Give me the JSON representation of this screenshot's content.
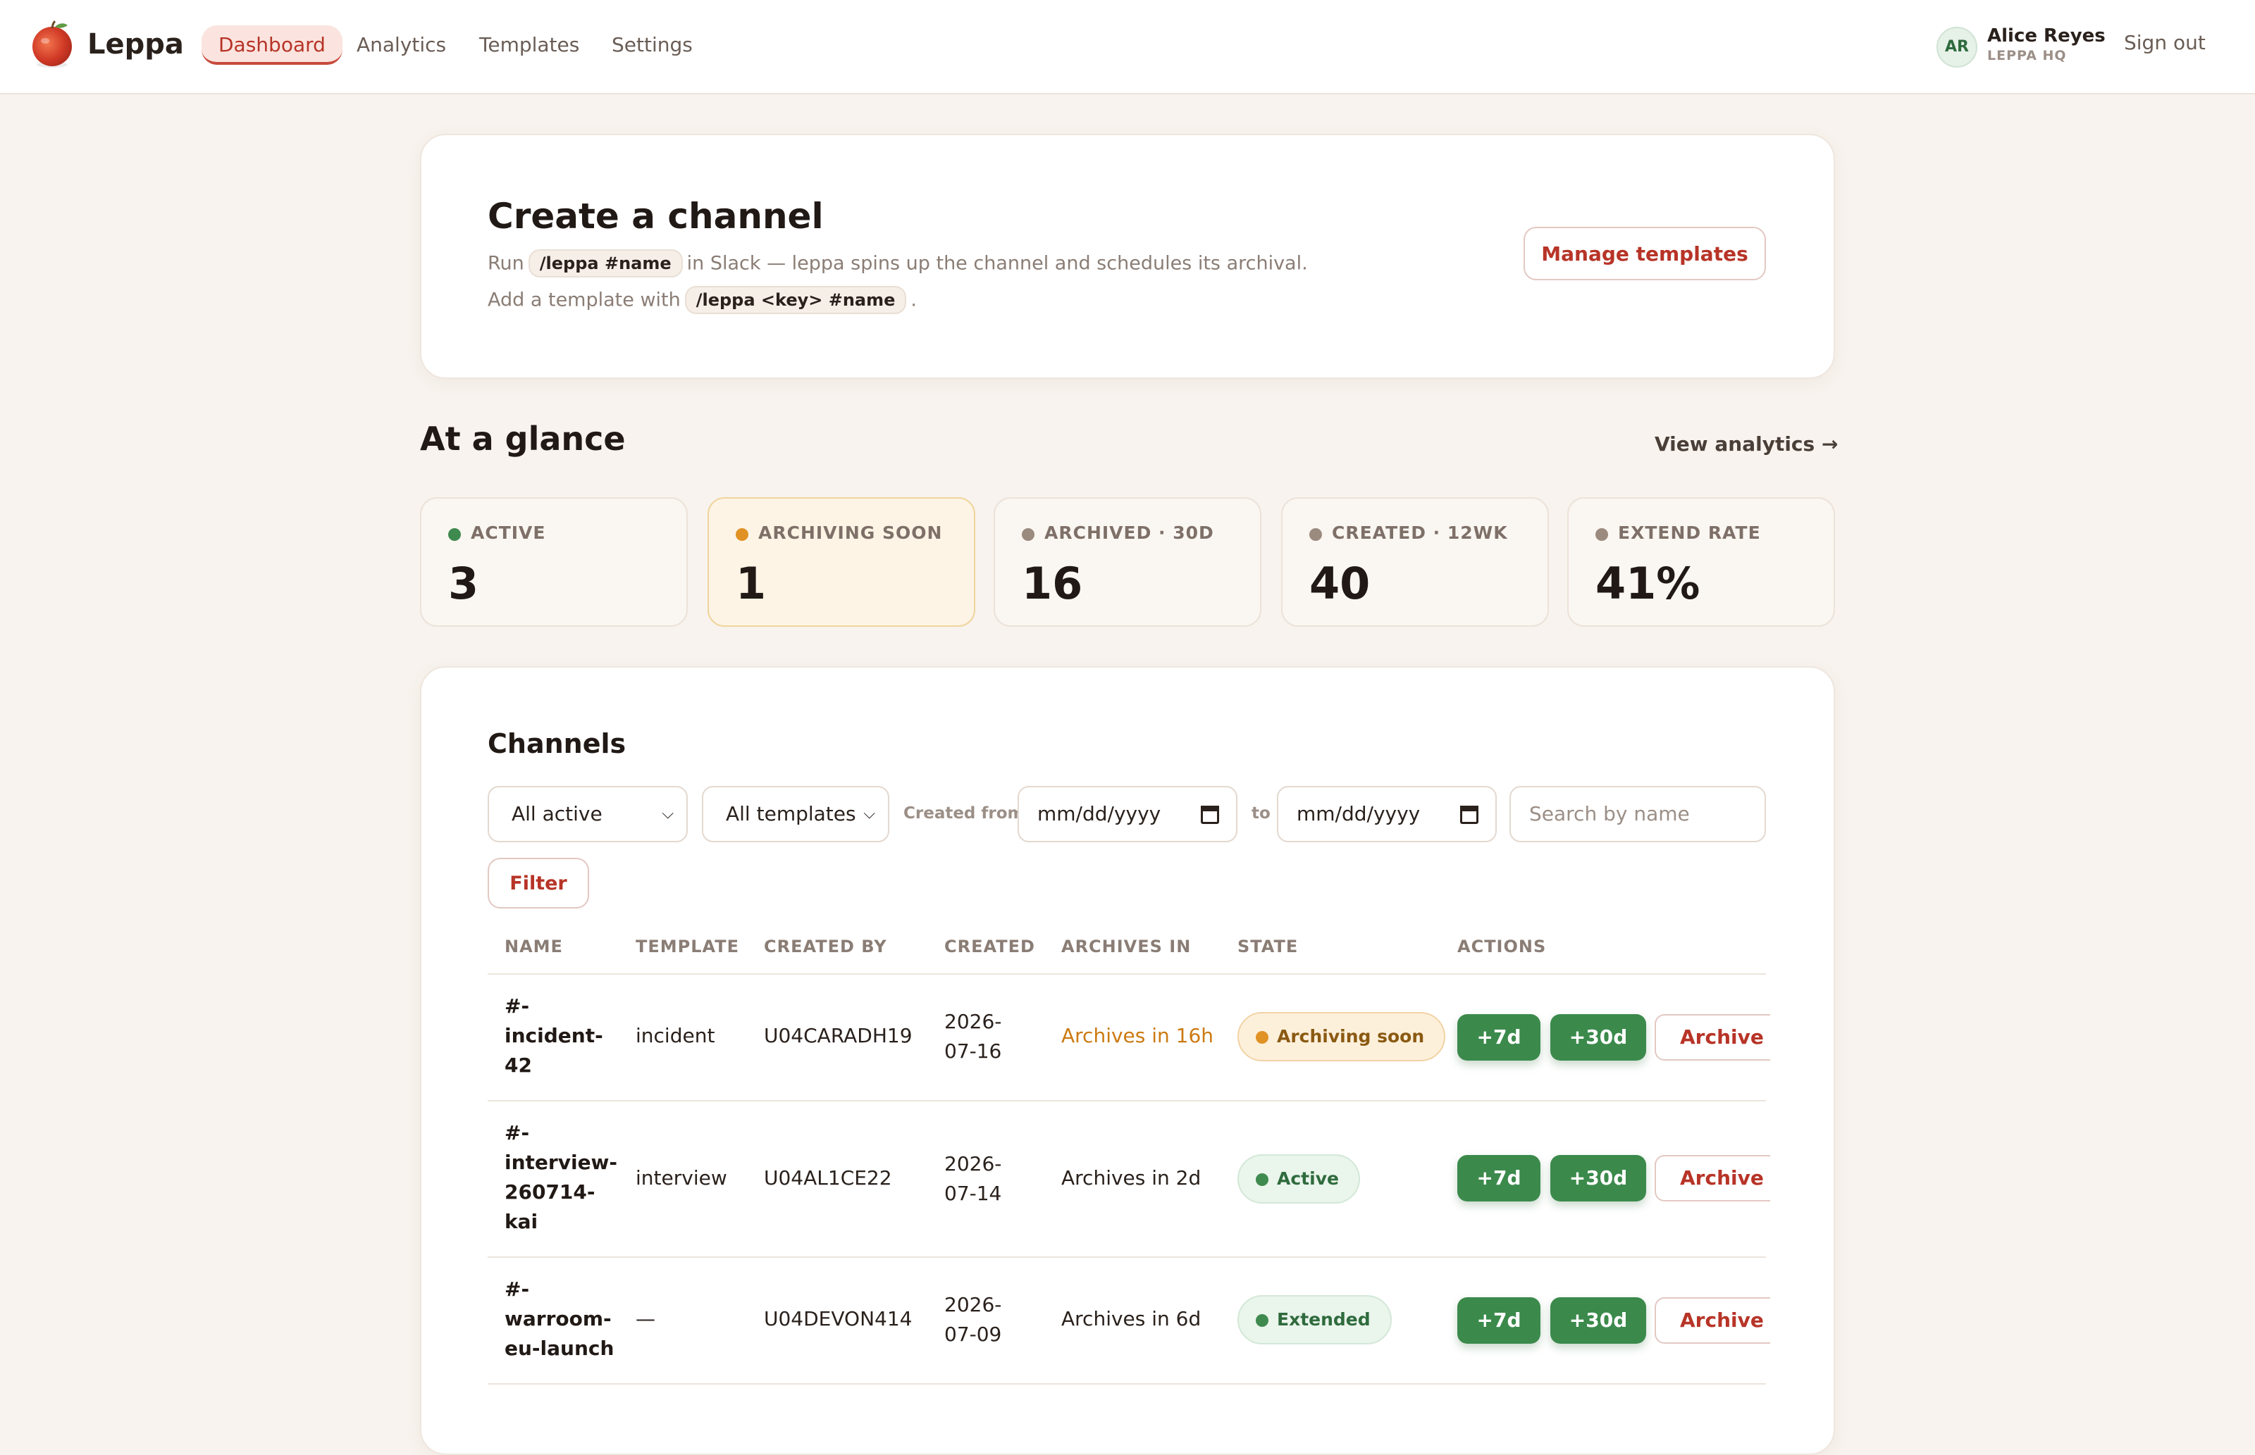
{
  "app": {
    "brand": "Leppa"
  },
  "nav": {
    "items": [
      {
        "label": "Dashboard",
        "active": true
      },
      {
        "label": "Analytics"
      },
      {
        "label": "Templates"
      },
      {
        "label": "Settings"
      }
    ]
  },
  "user": {
    "initials": "AR",
    "name": "Alice Reyes",
    "org": "LEPPA HQ",
    "signout_label": "Sign out"
  },
  "create": {
    "title": "Create a channel",
    "line1_pre": "Run",
    "line1_code": "/leppa #name",
    "line1_post": "in Slack — leppa spins up the channel and schedules its archival.",
    "line2_pre": "Add a template with",
    "line2_code": "/leppa <key> #name",
    "line2_post": ".",
    "manage_label": "Manage templates"
  },
  "glance": {
    "title": "At a glance",
    "view_analytics": "View analytics →",
    "stats": [
      {
        "label": "ACTIVE",
        "value": "3",
        "dot_color": "#3f8a4f"
      },
      {
        "label": "ARCHIVING SOON",
        "value": "1",
        "dot_color": "#e19224"
      },
      {
        "label": "ARCHIVED · 30D",
        "value": "16",
        "dot_color": "#9b8a7e"
      },
      {
        "label": "CREATED · 12WK",
        "value": "40",
        "dot_color": "#9b8a7e"
      },
      {
        "label": "EXTEND RATE",
        "value": "41%",
        "dot_color": "#9b8a7e"
      }
    ]
  },
  "channels": {
    "title": "Channels",
    "filters": {
      "status": "All active",
      "template": "All templates",
      "created_from_label": "Created from",
      "to_label": "to",
      "date_placeholder": "mm/dd/yyyy",
      "search_placeholder": "Search by name",
      "filter_label": "Filter"
    },
    "columns": [
      "NAME",
      "TEMPLATE",
      "CREATED BY",
      "CREATED",
      "ARCHIVES IN",
      "STATE",
      "ACTIONS"
    ],
    "rows": [
      {
        "name_lines": [
          "#-",
          "incident-",
          "42"
        ],
        "template": "incident",
        "created_by": "U04CARADH19",
        "created_lines": [
          "2026-",
          "07-16"
        ],
        "archives_in": "Archives in 16h",
        "state": "Archiving soon",
        "extend7": "+7d",
        "extend30": "+30d",
        "archive": "Archive now"
      },
      {
        "name_lines": [
          "#-",
          "interview-",
          "260714-",
          "kai"
        ],
        "template": "interview",
        "created_by": "U04AL1CE22",
        "created_lines": [
          "2026-",
          "07-14"
        ],
        "archives_in": "Archives in 2d",
        "state": "Active",
        "extend7": "+7d",
        "extend30": "+30d",
        "archive": "Archive now"
      },
      {
        "name_lines": [
          "#-",
          "warroom-",
          "eu-launch"
        ],
        "template": "—",
        "created_by": "U04DEVON414",
        "created_lines": [
          "2026-",
          "07-09"
        ],
        "archives_in": "Archives in 6d",
        "state": "Extended",
        "extend7": "+7d",
        "extend30": "+30d",
        "archive": "Archive now"
      }
    ]
  }
}
